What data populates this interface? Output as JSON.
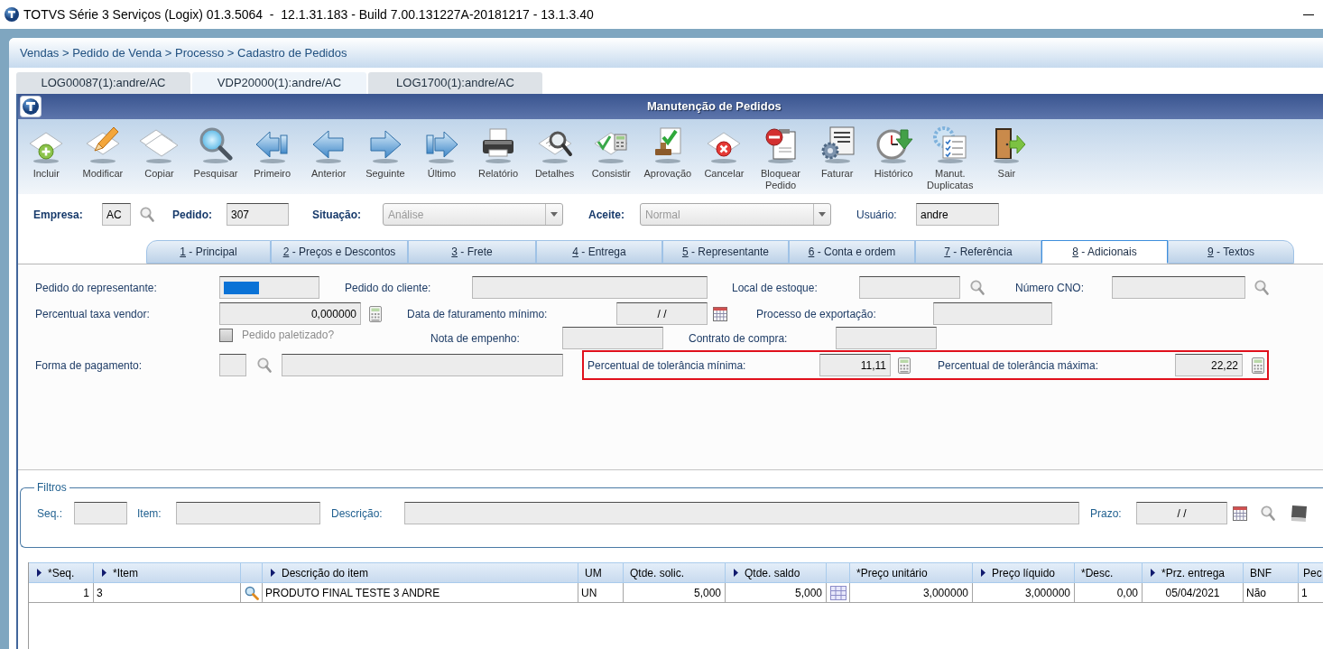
{
  "window": {
    "title": "TOTVS Série 3 Serviços (Logix) 01.3.5064  -  12.1.31.183 - Build 7.00.131227A-20181217 - 13.1.3.40"
  },
  "breadcrumb": "Vendas > Pedido de Venda > Processo > Cadastro de Pedidos",
  "session_tabs": [
    {
      "label": "LOG00087(1):andre/AC",
      "selected": false
    },
    {
      "label": "VDP20000(1):andre/AC",
      "selected": true
    },
    {
      "label": "LOG1700(1):andre/AC",
      "selected": false
    }
  ],
  "dialog": {
    "title": "Manutenção de Pedidos"
  },
  "toolbar": [
    {
      "label": "Incluir",
      "kind": "add"
    },
    {
      "label": "Modificar",
      "kind": "edit"
    },
    {
      "label": "Copiar",
      "kind": "copy"
    },
    {
      "label": "Pesquisar",
      "kind": "search"
    },
    {
      "label": "Primeiro",
      "kind": "first"
    },
    {
      "label": "Anterior",
      "kind": "previous"
    },
    {
      "label": "Seguinte",
      "kind": "next"
    },
    {
      "label": "Último",
      "kind": "last"
    },
    {
      "label": "Relatório",
      "kind": "report"
    },
    {
      "label": "Detalhes",
      "kind": "details"
    },
    {
      "label": "Consistir",
      "kind": "validate"
    },
    {
      "label": "Aprovação",
      "kind": "approve"
    },
    {
      "label": "Cancelar",
      "kind": "cancel"
    },
    {
      "label": "Bloquear Pedido",
      "kind": "block"
    },
    {
      "label": "Faturar",
      "kind": "invoice"
    },
    {
      "label": "Histórico",
      "kind": "history"
    },
    {
      "label": "Manut. Duplicatas",
      "kind": "installments"
    },
    {
      "label": "Sair",
      "kind": "exit"
    }
  ],
  "header_fields": [
    {
      "label": "Empresa:",
      "required": true,
      "kind": "lookup",
      "value": "AC"
    },
    {
      "label": "Pedido:",
      "required": true,
      "kind": "input",
      "value": "307"
    },
    {
      "label": "Situação:",
      "required": true,
      "kind": "select",
      "value": "Análise"
    },
    {
      "label": "Aceite:",
      "required": true,
      "kind": "select",
      "value": "Normal"
    },
    {
      "label": "Usuário:",
      "required": false,
      "kind": "input",
      "value": "andre"
    }
  ],
  "form_tabs": [
    {
      "key": "1",
      "label": "- Principal",
      "selected": false
    },
    {
      "key": "2",
      "label": "- Preços e Descontos",
      "selected": false
    },
    {
      "key": "3",
      "label": "- Frete",
      "selected": false
    },
    {
      "key": "4",
      "label": "- Entrega",
      "selected": false
    },
    {
      "key": "5",
      "label": "- Representante",
      "selected": false
    },
    {
      "key": "6",
      "label": "- Conta e ordem",
      "selected": false
    },
    {
      "key": "7",
      "label": "- Referência",
      "selected": false
    },
    {
      "key": "8",
      "label": "- Adicionais",
      "selected": true
    },
    {
      "key": "9",
      "label": "- Textos",
      "selected": false
    }
  ],
  "form": {
    "rows": [
      {
        "items": [
          {
            "kind": "label",
            "text": "Pedido do representante:"
          },
          {
            "kind": "input",
            "focused": true
          },
          {
            "kind": "label",
            "text": "Pedido do cliente:"
          },
          {
            "kind": "input",
            "focused": false
          },
          {
            "kind": "label",
            "text": "Local de estoque:"
          },
          {
            "kind": "input",
            "focused": false
          },
          {
            "kind": "lookup"
          },
          {
            "kind": "label",
            "text": "Número CNO:"
          },
          {
            "kind": "input",
            "focused": false
          },
          {
            "kind": "lookup"
          }
        ]
      },
      {
        "items": [
          {
            "kind": "label",
            "text": "Percentual taxa vendor:"
          },
          {
            "kind": "number",
            "value": "0,000000",
            "focused": false
          },
          {
            "kind": "calculator"
          },
          {
            "kind": "label",
            "text": "Data de faturamento mínimo:"
          },
          {
            "kind": "date",
            "value": "/ /",
            "focused": false
          },
          {
            "kind": "calendar"
          },
          {
            "kind": "label",
            "text": "Processo de exportação:"
          },
          {
            "kind": "input",
            "focused": false
          }
        ]
      },
      {
        "items": [
          {
            "kind": "checkbox",
            "label": "Pedido paletizado?",
            "checked": false,
            "disabled": true
          },
          {
            "kind": "label",
            "text": "Nota de empenho:"
          },
          {
            "kind": "input",
            "focused": false
          },
          {
            "kind": "label",
            "text": "Contrato de compra:"
          },
          {
            "kind": "input",
            "focused": false
          }
        ]
      },
      {
        "items": [
          {
            "kind": "label",
            "text": "Forma de pagamento:"
          },
          {
            "kind": "input",
            "focused": false
          },
          {
            "kind": "lookup"
          },
          {
            "kind": "input",
            "focused": false
          },
          {
            "kind": "highlight",
            "items": [
              {
                "kind": "label",
                "text": "Percentual de tolerância mínima:"
              },
              {
                "kind": "number",
                "value": "11,11",
                "focused": false
              },
              {
                "kind": "calculator"
              },
              {
                "kind": "label",
                "text": "Percentual de tolerância máxima:"
              },
              {
                "kind": "number",
                "value": "22,22",
                "focused": false
              },
              {
                "kind": "calculator"
              }
            ]
          }
        ]
      }
    ]
  },
  "filters": {
    "title": "Filtros",
    "fields": [
      {
        "label": "Seq.:",
        "kind": "input"
      },
      {
        "label": "Item:",
        "kind": "input"
      },
      {
        "label": "Descrição:",
        "kind": "input"
      },
      {
        "label": "Prazo:",
        "kind": "date",
        "value": "/ /"
      }
    ]
  },
  "table": {
    "columns": [
      {
        "label": "*Seq.",
        "sortable": true,
        "kind": "number"
      },
      {
        "label": "*Item",
        "sortable": true,
        "kind": "text"
      },
      {
        "sortable": false,
        "kind": "lookup"
      },
      {
        "label": "Descrição do item",
        "sortable": true,
        "kind": "text"
      },
      {
        "label": "UM",
        "sortable": false,
        "kind": "text"
      },
      {
        "label": "Qtde. solic.",
        "sortable": false,
        "kind": "number"
      },
      {
        "label": "Qtde. saldo",
        "sortable": true,
        "kind": "number"
      },
      {
        "sortable": false,
        "kind": "grid"
      },
      {
        "label": "*Preço unitário",
        "sortable": false,
        "kind": "number"
      },
      {
        "label": "Preço líquido",
        "sortable": true,
        "kind": "number"
      },
      {
        "label": "*Desc.",
        "sortable": false,
        "kind": "number"
      },
      {
        "label": "*Prz. entrega",
        "sortable": true,
        "kind": "date"
      },
      {
        "label": "BNF",
        "sortable": false,
        "kind": "text"
      },
      {
        "label": "Pec",
        "sortable": false,
        "kind": "text"
      }
    ],
    "rows": [
      {
        "cells": [
          "1",
          "3",
          "",
          "PRODUTO FINAL TESTE 3 ANDRE",
          "UN",
          "5,000",
          "5,000",
          "",
          "3,000000",
          "3,000000",
          "0,00",
          "05/04/2021",
          "Não",
          "1"
        ]
      }
    ]
  }
}
